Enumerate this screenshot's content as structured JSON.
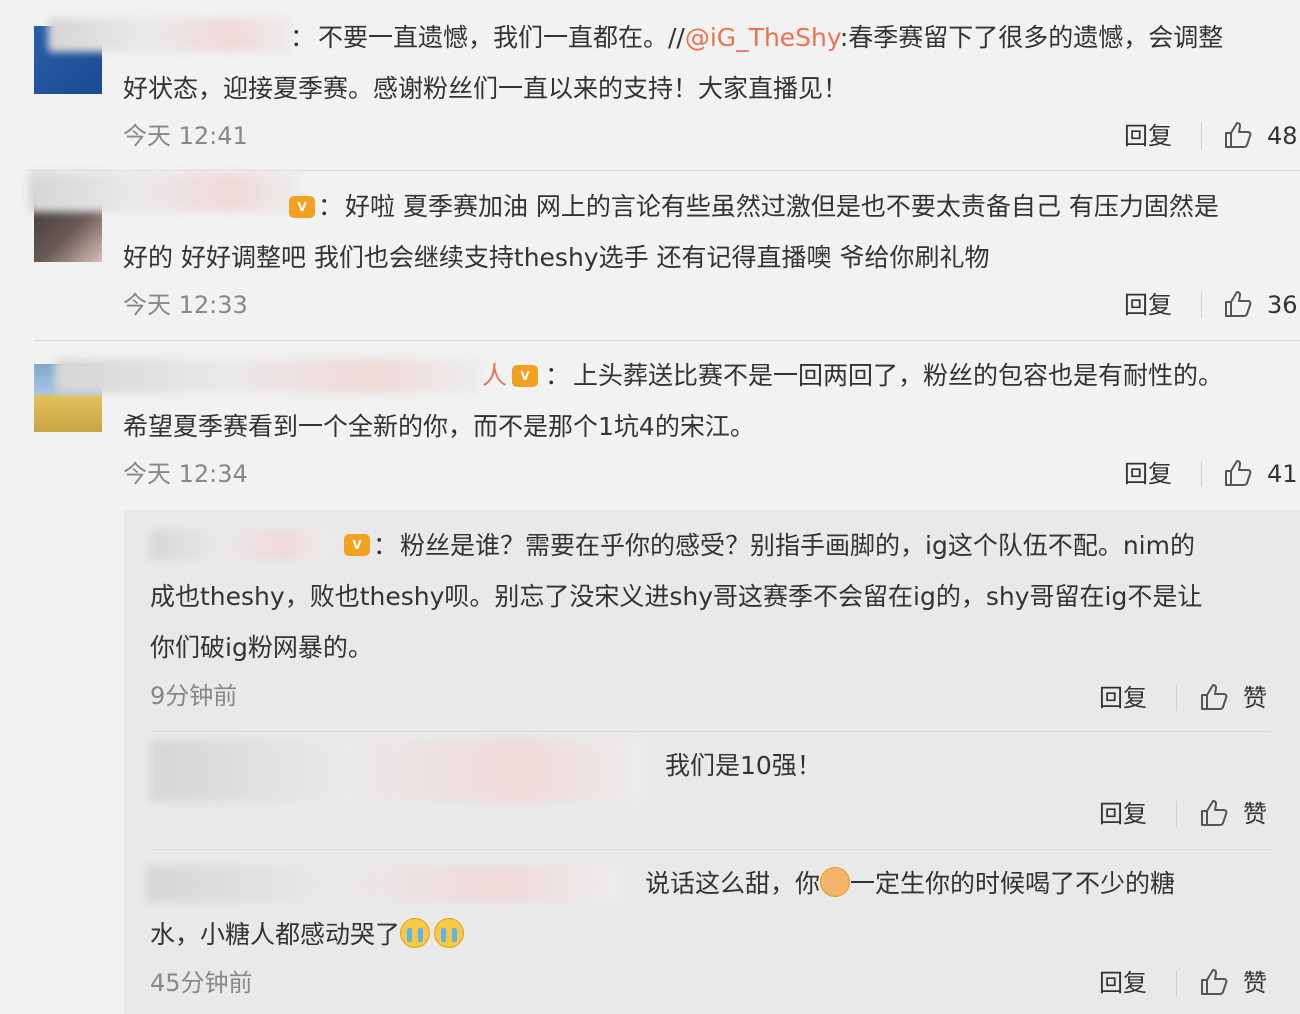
{
  "comments": [
    {
      "separator": "：",
      "text1_a": "不要一直遗憾，我们一直都在。//",
      "mention": "@iG_TheShy",
      "text1_b": ":春季赛留下了很多的遗憾，会调整",
      "text2": "好状态，迎接夏季赛。感谢粉丝们一直以来的支持！大家直播见！",
      "time": "今天 12:41",
      "reply": "回复",
      "likes": "48"
    },
    {
      "separator": "：",
      "text1": "好啦 夏季赛加油 网上的言论有些虽然过激但是也不要太责备自己 有压力固然是",
      "text2": "好的 好好调整吧 我们也会继续支持theshy选手 还有记得直播噢 爷给你刷礼物",
      "time": "今天 12:33",
      "reply": "回复",
      "likes": "36"
    },
    {
      "name_tail": "人",
      "separator": "：",
      "text1": "上头葬送比赛不是一回两回了，粉丝的包容也是有耐性的。",
      "text2": "希望夏季赛看到一个全新的你，而不是那个1坑4的宋江。",
      "time": "今天 12:34",
      "reply": "回复",
      "likes": "41"
    }
  ],
  "subcomments": [
    {
      "separator": "：",
      "text1": "粉丝是谁？需要在乎你的感受？别指手画脚的，ig这个队伍不配。nim的",
      "text2": "成也theshy，败也theshy呗。别忘了没宋义进shy哥这赛季不会留在ig的，shy哥留在ig不是让",
      "text3": "你们破ig粉网暴的。",
      "time": "9分钟前",
      "reply": "回复",
      "like": "赞"
    },
    {
      "text1": "我们是10强！",
      "reply": "回复",
      "like": "赞"
    },
    {
      "text1_a": "说话这么甜，你",
      "text1_b": "一定生你的时候喝了不少的糖",
      "text2": "水，小糖人都感动哭了",
      "time": "45分钟前",
      "reply": "回复",
      "like": "赞"
    }
  ],
  "colors": {
    "mention": "#eb7350",
    "vip_badge": "#f4a021"
  }
}
